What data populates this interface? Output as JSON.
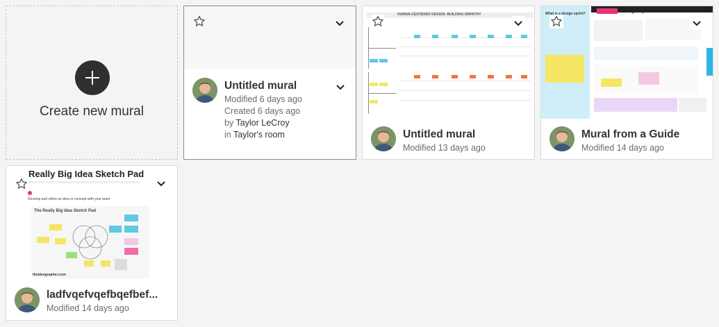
{
  "create_card": {
    "label": "Create new mural"
  },
  "murals": [
    {
      "title": "Untitled mural",
      "modified": "Modified 6 days ago",
      "created": "Created 6 days ago",
      "by_prefix": "by ",
      "author": "Taylor LeCroy",
      "in_prefix": "in ",
      "room": "Taylor's room"
    },
    {
      "title": "Untitled mural",
      "modified": "Modified 13 days ago",
      "thumb_heading": "HUMAN-CENTERED DESIGN: BUILDING EMPATHY"
    },
    {
      "title": "Mural from a Guide",
      "modified": "Modified 14 days ago",
      "thumb_heading": "Design Sprints Online",
      "thumb_side_heading": "What is a design sprint?"
    },
    {
      "title": "ladfvqefvqefbqefbef...",
      "modified": "Modified 14 days ago",
      "thumb_heading": "Really Big Idea Sketch Pad",
      "thumb_sub": "Develop and refine an idea or concept with your team",
      "thumb_pad_title": "The Really Big Idea Sketch Pad",
      "thumb_footer": "theideographer.com"
    }
  ],
  "colors": {
    "sticky_blue": "#5ec8e5",
    "sticky_orange": "#f0783c",
    "sticky_yellow": "#f5e663",
    "sticky_pink": "#f06ba8",
    "sticky_green": "#9be07a",
    "guide_cyan": "#cfeefa",
    "accent_pink": "#e8337a"
  },
  "icons": [
    "plus-icon",
    "star-icon",
    "chevron-down-icon"
  ]
}
